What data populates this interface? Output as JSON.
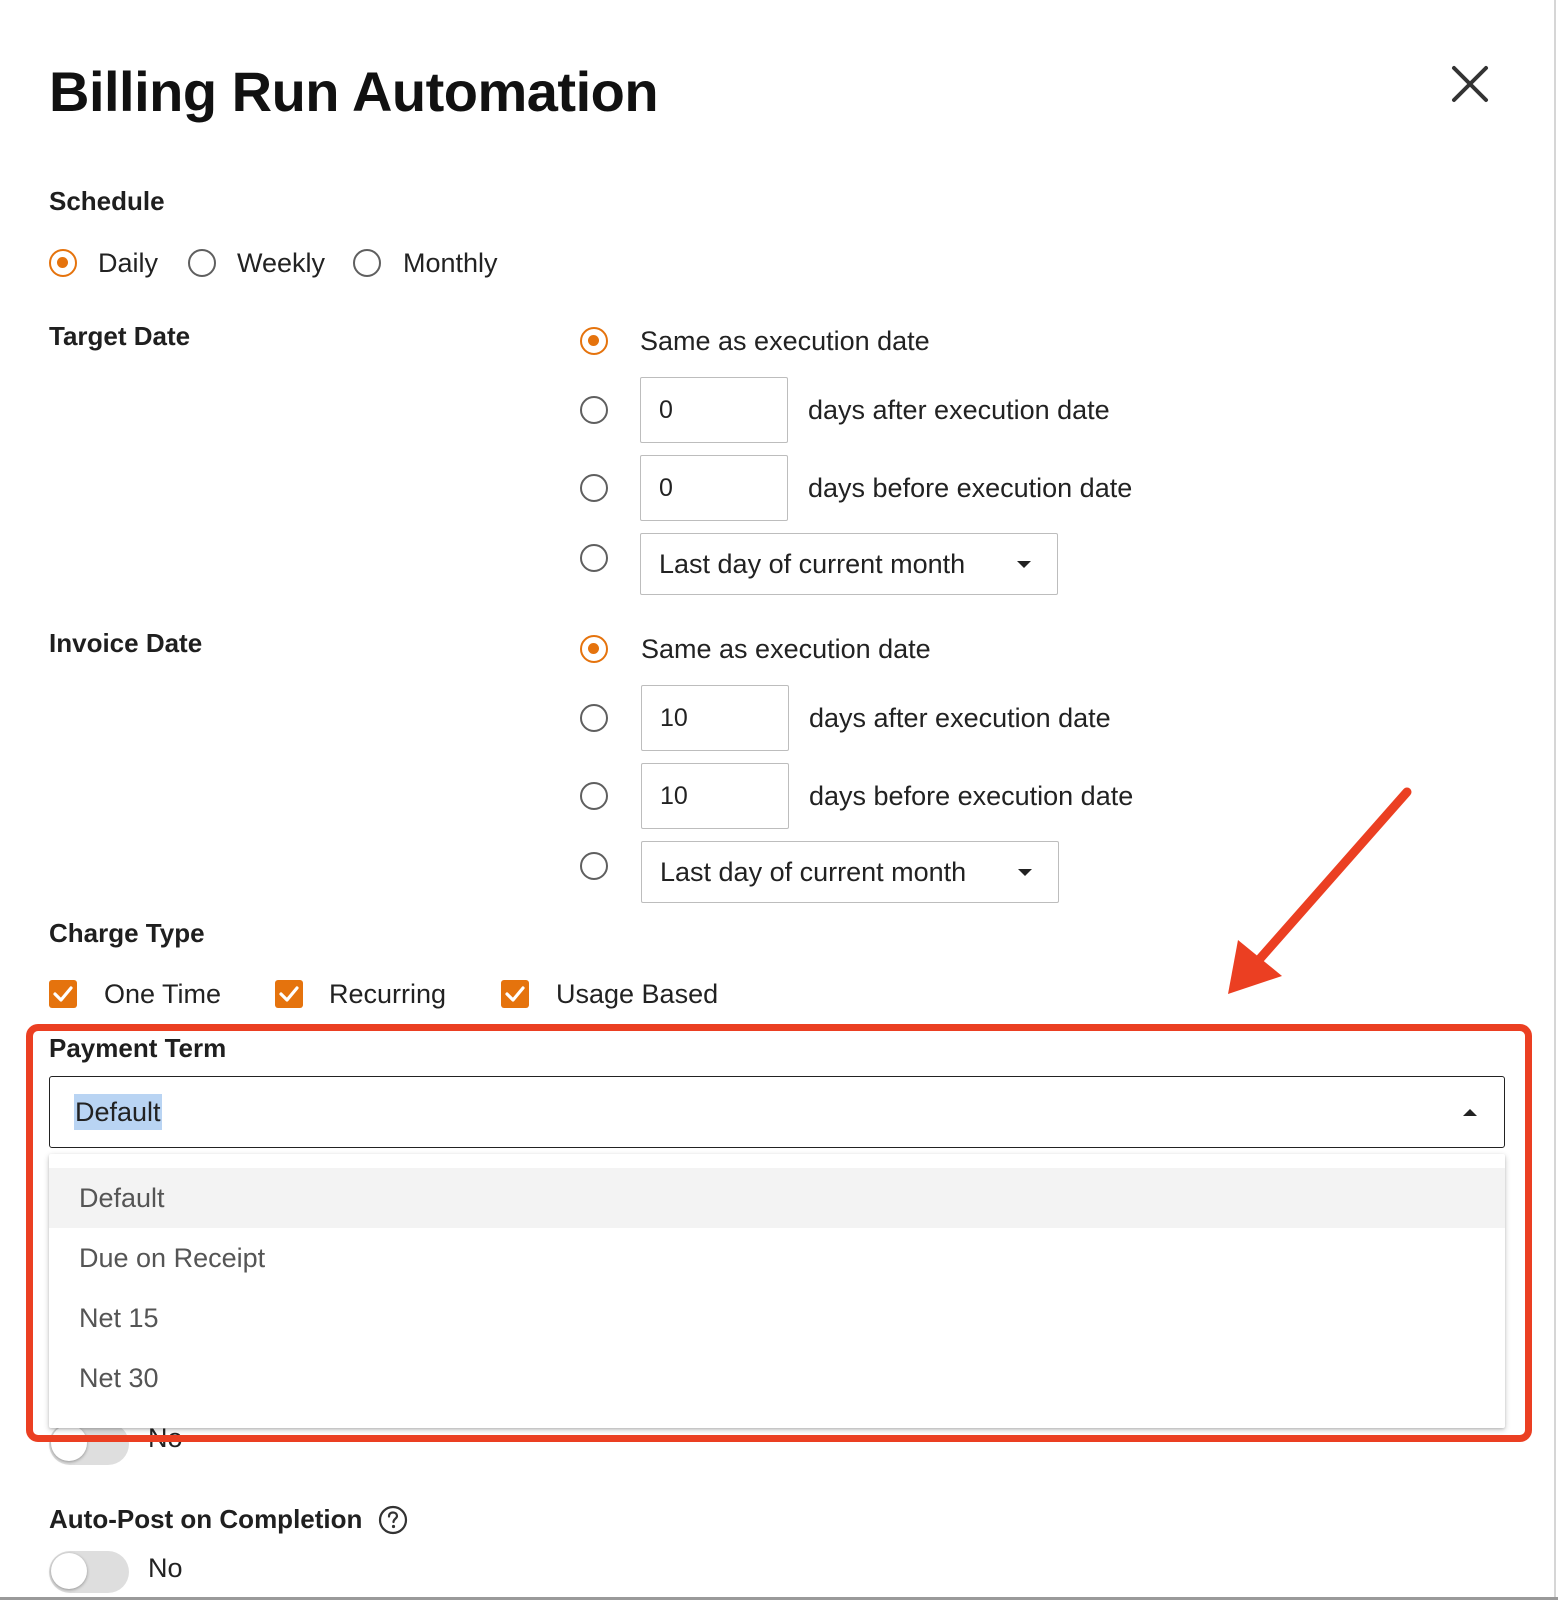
{
  "dialog": {
    "title": "Billing Run Automation",
    "close_icon": "close-icon"
  },
  "schedule": {
    "label": "Schedule",
    "options": [
      {
        "label": "Daily",
        "checked": true
      },
      {
        "label": "Weekly",
        "checked": false
      },
      {
        "label": "Monthly",
        "checked": false
      }
    ]
  },
  "target_date": {
    "label": "Target Date",
    "same_label": "Same as execution date",
    "after_value": "0",
    "after_label": "days after execution date",
    "before_value": "0",
    "before_label": "days before execution date",
    "select_value": "Last day of current month"
  },
  "invoice_date": {
    "label": "Invoice Date",
    "same_label": "Same as execution date",
    "after_value": "10",
    "after_label": "days after execution date",
    "before_value": "10",
    "before_label": "days before execution date",
    "select_value": "Last day of current month"
  },
  "charge_type": {
    "label": "Charge Type",
    "options": [
      {
        "label": "One Time",
        "checked": true
      },
      {
        "label": "Recurring",
        "checked": true
      },
      {
        "label": "Usage Based",
        "checked": true
      }
    ]
  },
  "payment_term": {
    "label": "Payment Term",
    "value": "Default",
    "options": [
      "Default",
      "Due on Receipt",
      "Net 15",
      "Net 30"
    ],
    "highlighted_option": "Default"
  },
  "hidden_toggle": {
    "label": "No"
  },
  "auto_post": {
    "label": "Auto-Post on Completion",
    "toggle_label": "No",
    "help_icon": "help-circle-icon"
  },
  "colors": {
    "accent": "#e5730d",
    "annotation": "#eb3f22",
    "selection": "#b9d4f3"
  }
}
